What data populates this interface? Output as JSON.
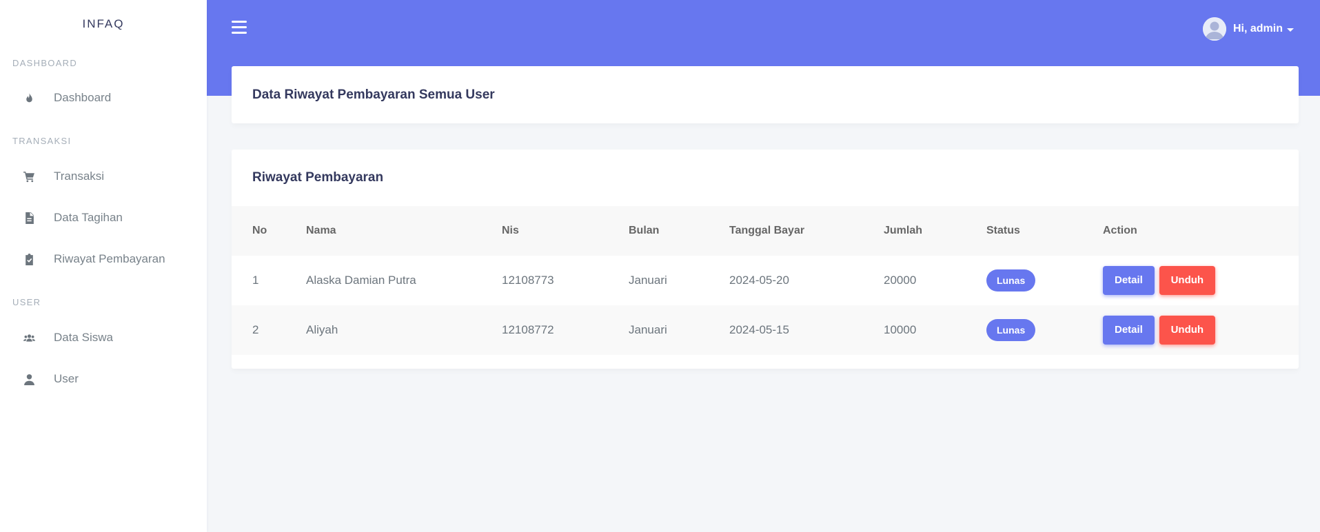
{
  "app": {
    "brand": "INFAQ"
  },
  "sidebar": {
    "sections": [
      {
        "header": "DASHBOARD",
        "items": [
          {
            "label": "Dashboard",
            "icon": "fire-icon"
          }
        ]
      },
      {
        "header": "TRANSAKSI",
        "items": [
          {
            "label": "Transaksi",
            "icon": "cart-icon"
          },
          {
            "label": "Data Tagihan",
            "icon": "invoice-icon"
          },
          {
            "label": "Riwayat Pembayaran",
            "icon": "clipboard-check-icon"
          }
        ]
      },
      {
        "header": "USER",
        "items": [
          {
            "label": "Data Siswa",
            "icon": "users-icon"
          },
          {
            "label": "User",
            "icon": "user-icon"
          }
        ]
      }
    ]
  },
  "topbar": {
    "menu_icon": "hamburger-icon",
    "user_greeting": "Hi, admin"
  },
  "page": {
    "title": "Data Riwayat Pembayaran Semua User"
  },
  "card": {
    "title": "Riwayat Pembayaran",
    "table": {
      "headers": [
        "No",
        "Nama",
        "Nis",
        "Bulan",
        "Tanggal Bayar",
        "Jumlah",
        "Status",
        "Action"
      ],
      "rows": [
        {
          "no": "1",
          "nama": "Alaska Damian Putra",
          "nis": "12108773",
          "bulan": "Januari",
          "tanggal": "2024-05-20",
          "jumlah": "20000",
          "status": "Lunas",
          "detail": "Detail",
          "unduh": "Unduh"
        },
        {
          "no": "2",
          "nama": "Aliyah",
          "nis": "12108772",
          "bulan": "Januari",
          "tanggal": "2024-05-15",
          "jumlah": "10000",
          "status": "Lunas",
          "detail": "Detail",
          "unduh": "Unduh"
        }
      ]
    }
  },
  "colors": {
    "primary": "#6777ef",
    "danger": "#fc544b",
    "background": "#f4f6f9"
  }
}
